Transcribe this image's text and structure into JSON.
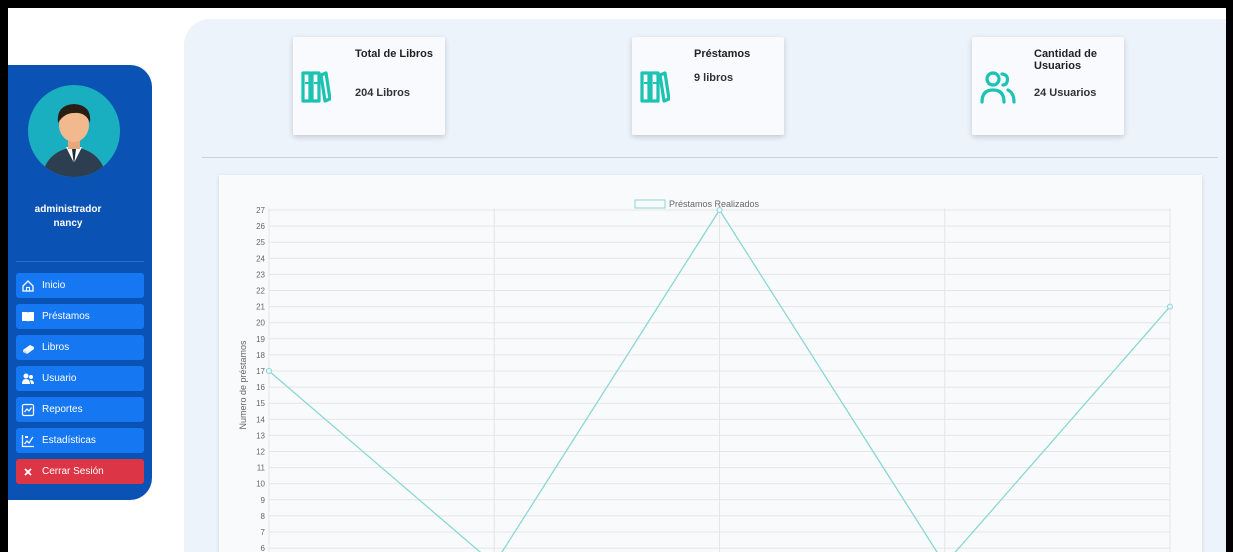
{
  "user": {
    "line1": "administrador",
    "line2": "nancy"
  },
  "menu": [
    {
      "label": "Inicio",
      "icon": "house-icon"
    },
    {
      "label": "Préstamos",
      "icon": "book-open-icon"
    },
    {
      "label": "Libros",
      "icon": "books-icon"
    },
    {
      "label": "Usuario",
      "icon": "users-icon"
    },
    {
      "label": "Reportes",
      "icon": "report-icon"
    },
    {
      "label": "Estadísticas",
      "icon": "stats-icon"
    },
    {
      "label": "Cerrar Sesión",
      "icon": "close-icon"
    }
  ],
  "cards": [
    {
      "title": "Total de Libros",
      "value": "204 Libros",
      "icon": "books-icon"
    },
    {
      "title": "Préstamos",
      "value": "9 libros",
      "icon": "books-icon"
    },
    {
      "title": "Cantidad de Usuarios",
      "value": "24 Usuarios",
      "icon": "users-icon"
    }
  ],
  "colors": {
    "sidebar": "#0b52b5",
    "menu_button": "#1677f2",
    "logout": "#dc3545",
    "accent": "#1cc2b2",
    "line": "#8ad7d6"
  },
  "chart_data": {
    "type": "line",
    "series": [
      {
        "name": "Préstamos Realizados",
        "values": [
          17,
          5,
          27,
          5,
          21
        ]
      }
    ],
    "ylabel": "Numero de préstamos",
    "yticks": [
      27,
      26,
      25,
      24,
      23,
      22,
      21,
      20,
      19,
      18,
      17,
      16,
      15,
      14,
      13,
      12,
      11,
      10,
      9,
      8,
      7,
      6
    ],
    "ylim": [
      5,
      27
    ],
    "grid": true,
    "legend": "top"
  }
}
